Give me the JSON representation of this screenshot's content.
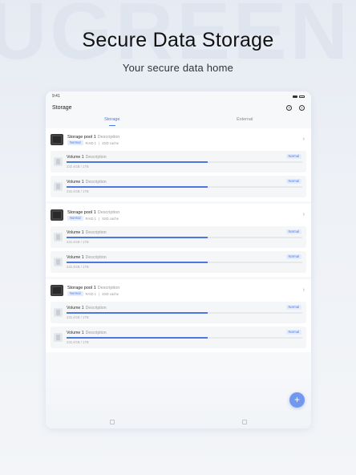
{
  "backdrop": {
    "watermark": "UGREEN"
  },
  "hero": {
    "title": "Secure Data Storage",
    "subtitle": "Your secure data home"
  },
  "device": {
    "status_time": "9:41",
    "app_title": "Storage",
    "help_icon": "question-icon",
    "add_icon": "plus-circle-icon",
    "tabs": [
      {
        "label": "Storage",
        "active": true
      },
      {
        "label": "External",
        "active": false
      }
    ],
    "pools": [
      {
        "name": "Storage pool 1",
        "description": "Description",
        "status": "Normal",
        "raid": "RAID 1",
        "cache": "SSD cache",
        "volumes": [
          {
            "name": "Volume 1",
            "description": "Description",
            "status": "Normal",
            "size": "232.4GB / 1TB",
            "usage": 0.6
          },
          {
            "name": "Volume 1",
            "description": "Description",
            "status": "Normal",
            "size": "232.4GB / 1TB",
            "usage": 0.6
          }
        ]
      },
      {
        "name": "Storage pool 1",
        "description": "Description",
        "status": "Normal",
        "raid": "RAID 1",
        "cache": "SSD cache",
        "volumes": [
          {
            "name": "Volume 1",
            "description": "Description",
            "status": "Normal",
            "size": "232.4GB / 1TB",
            "usage": 0.6
          },
          {
            "name": "Volume 1",
            "description": "Description",
            "status": "Normal",
            "size": "232.4GB / 1TB",
            "usage": 0.6
          }
        ]
      },
      {
        "name": "Storage pool 1",
        "description": "Description",
        "status": "Normal",
        "raid": "RAID 1",
        "cache": "SSD cache",
        "volumes": [
          {
            "name": "Volume 1",
            "description": "Description",
            "status": "Normal",
            "size": "232.4GB / 1TB",
            "usage": 0.6
          },
          {
            "name": "Volume 1",
            "description": "Description",
            "status": "Normal",
            "size": "232.4GB / 1TB",
            "usage": 0.6
          }
        ]
      }
    ],
    "fab_icon": "plus-icon",
    "fab_label": "+",
    "colors": {
      "accent": "#4a78e0",
      "fab": "#6f98ee",
      "badge_bg": "#e5edfc"
    }
  }
}
